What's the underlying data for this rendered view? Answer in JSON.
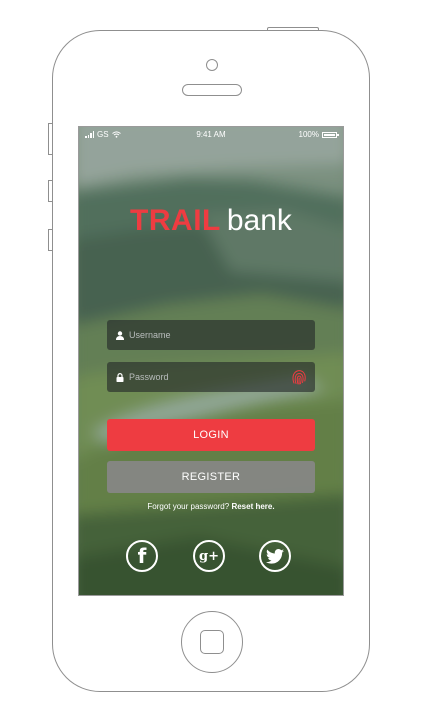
{
  "status_bar": {
    "carrier": "GS",
    "time": "9:41 AM",
    "battery": "100%"
  },
  "logo": {
    "brand": "TRAIL",
    "suffix": "bank"
  },
  "login_form": {
    "username_placeholder": "Username",
    "password_placeholder": "Password",
    "login_label": "LOGIN",
    "register_label": "REGISTER",
    "forgot_text": "Forgot your password?",
    "reset_link": "Reset here."
  },
  "social": [
    {
      "name": "facebook",
      "glyph": "f"
    },
    {
      "name": "google-plus",
      "glyph": "g+"
    },
    {
      "name": "twitter",
      "glyph": "twitter-bird"
    }
  ],
  "colors": {
    "accent": "#ee3c41",
    "register": "#878787",
    "field_bg": "#232828"
  }
}
